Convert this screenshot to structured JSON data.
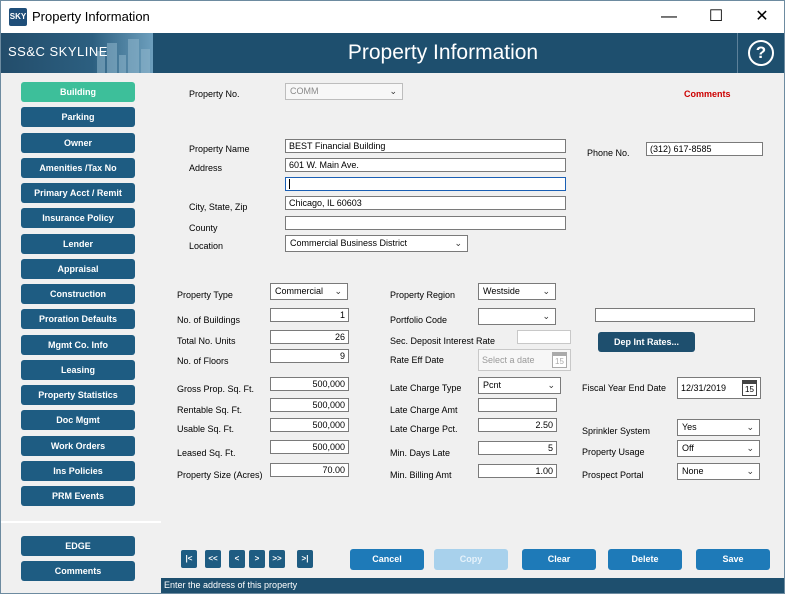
{
  "window": {
    "title": "Property Information",
    "icon_text": "SKY"
  },
  "header": {
    "logo": "SS&C SKYLINE",
    "title": "Property Information",
    "help": "?"
  },
  "sidebar": {
    "items": [
      {
        "label": "Building",
        "active": true
      },
      {
        "label": "Parking"
      },
      {
        "label": "Owner"
      },
      {
        "label": "Amenities /Tax No"
      },
      {
        "label": "Primary Acct / Remit"
      },
      {
        "label": "Insurance Policy"
      },
      {
        "label": "Lender"
      },
      {
        "label": "Appraisal"
      },
      {
        "label": "Construction"
      },
      {
        "label": "Proration Defaults"
      },
      {
        "label": "Mgmt Co. Info"
      },
      {
        "label": "Leasing"
      },
      {
        "label": "Property Statistics"
      },
      {
        "label": "Doc Mgmt"
      },
      {
        "label": "Work Orders"
      },
      {
        "label": "Ins Policies"
      },
      {
        "label": "PRM Events"
      }
    ],
    "bottom_items": [
      {
        "label": "EDGE"
      },
      {
        "label": "Comments"
      }
    ]
  },
  "form": {
    "property_no": {
      "label": "Property No.",
      "value": "COMM"
    },
    "comments_link": "Comments",
    "property_name": {
      "label": "Property Name",
      "value": "BEST Financial Building"
    },
    "address": {
      "label": "Address",
      "line1": "601 W. Main Ave.",
      "line2": ""
    },
    "city_state_zip": {
      "label": "City, State, Zip",
      "value": "Chicago, IL  60603"
    },
    "county": {
      "label": "County",
      "value": ""
    },
    "location": {
      "label": "Location",
      "value": "Commercial Business District"
    },
    "phone": {
      "label": "Phone No.",
      "value": "(312) 617-8585"
    },
    "property_type": {
      "label": "Property Type",
      "value": "Commercial"
    },
    "num_buildings": {
      "label": "No. of Buildings",
      "value": "1"
    },
    "total_units": {
      "label": "Total No. Units",
      "value": "26"
    },
    "num_floors": {
      "label": "No. of Floors",
      "value": "9"
    },
    "gross_sqft": {
      "label": "Gross Prop. Sq. Ft.",
      "value": "500,000"
    },
    "rentable_sqft": {
      "label": "Rentable Sq. Ft.",
      "value": "500,000"
    },
    "usable_sqft": {
      "label": "Usable Sq. Ft.",
      "value": "500,000"
    },
    "leased_sqft": {
      "label": "Leased Sq. Ft.",
      "value": "500,000"
    },
    "property_size": {
      "label": "Property Size (Acres)",
      "value": "70.00"
    },
    "property_region": {
      "label": "Property Region",
      "value": "Westside"
    },
    "portfolio_code": {
      "label": "Portfolio Code",
      "value": "",
      "extra_value": ""
    },
    "sec_deposit_rate": {
      "label": "Sec. Deposit Interest Rate",
      "value": ""
    },
    "rate_eff_date": {
      "label": "Rate Eff Date",
      "placeholder": "Select a date",
      "cal": "15"
    },
    "dep_int_rates_button": "Dep Int Rates...",
    "late_charge_type": {
      "label": "Late Charge Type",
      "value": "Pcnt"
    },
    "late_charge_amt": {
      "label": "Late Charge Amt",
      "value": ""
    },
    "late_charge_pct": {
      "label": "Late Charge Pct.",
      "value": "2.50"
    },
    "min_days_late": {
      "label": "Min. Days Late",
      "value": "5"
    },
    "min_billing_amt": {
      "label": "Min. Billing Amt",
      "value": "1.00"
    },
    "fiscal_year_end": {
      "label": "Fiscal Year End Date",
      "value": "12/31/2019",
      "cal": "15"
    },
    "sprinkler_system": {
      "label": "Sprinkler System",
      "value": "Yes"
    },
    "property_usage": {
      "label": "Property Usage",
      "value": "Off"
    },
    "prospect_portal": {
      "label": "Prospect Portal",
      "value": "None"
    }
  },
  "pagination": {
    "first": "|<",
    "prev_page": "<<",
    "prev": "<",
    "next": ">",
    "next_page": ">>",
    "last": ">|"
  },
  "actions": {
    "cancel": "Cancel",
    "copy": "Copy",
    "clear": "Clear",
    "delete": "Delete",
    "save": "Save"
  },
  "status": "Enter the address of this property",
  "icons": {
    "dropdown": "chevron-down-icon",
    "calendar": "calendar-icon",
    "help": "help-icon"
  },
  "colors": {
    "header": "#1e4f6e",
    "nav": "#1e5c82",
    "nav_active": "#3dbf9a",
    "action": "#1e7ab8",
    "comments": "#cc0000"
  }
}
